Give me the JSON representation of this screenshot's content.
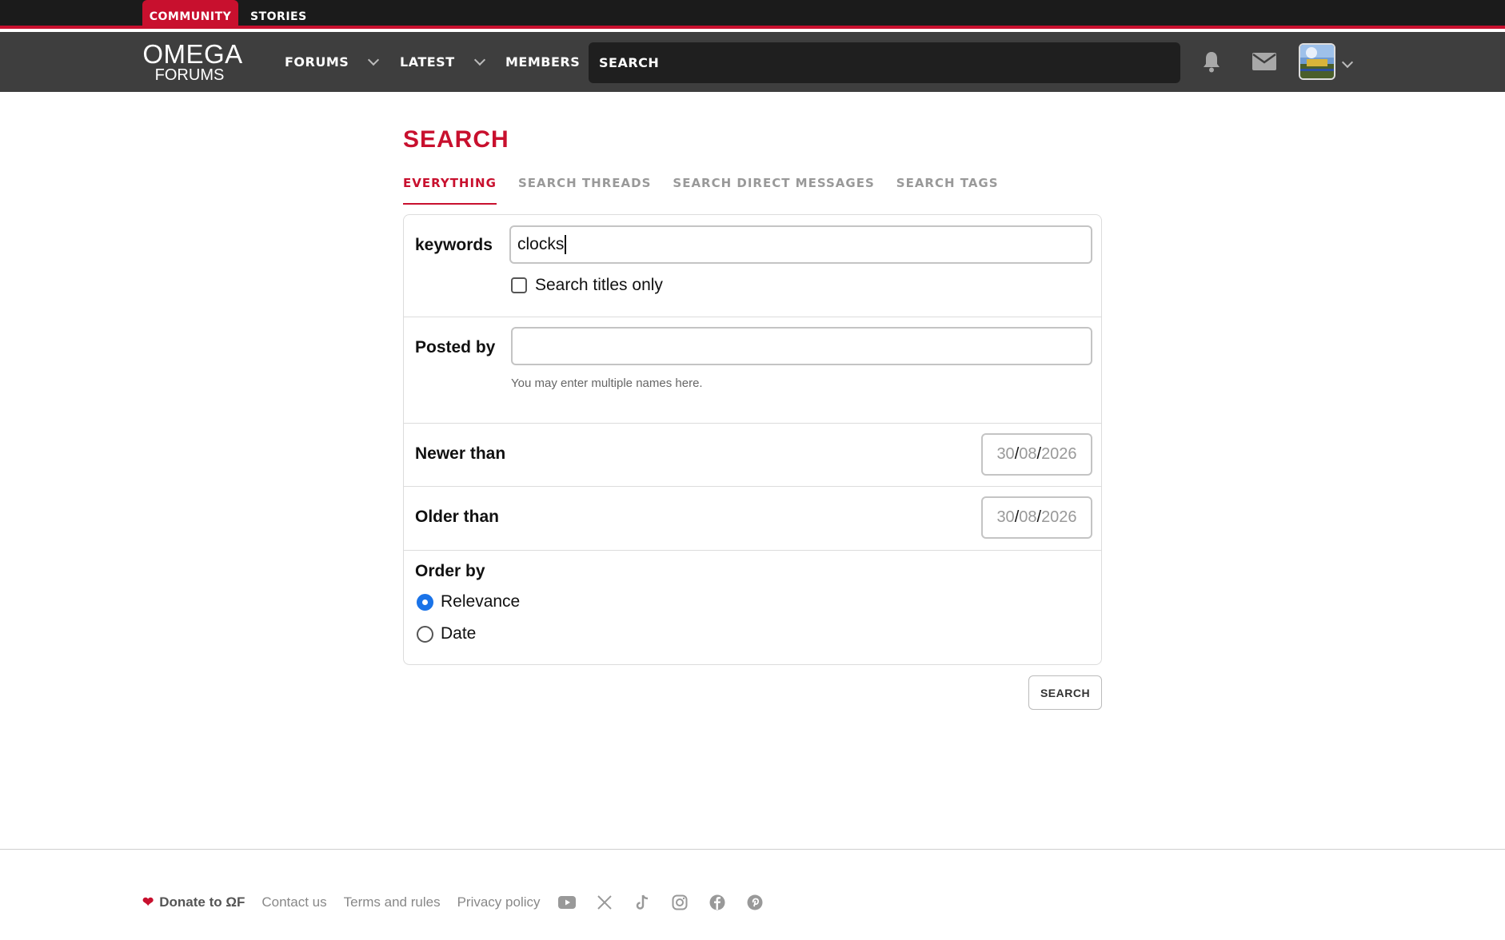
{
  "top_tabs": {
    "community": "COMMUNITY",
    "stories": "STORIES"
  },
  "logo": {
    "line1": "OMEGA",
    "line2": "FORUMS"
  },
  "nav": {
    "forums": "FORUMS",
    "latest": "LATEST",
    "members": "MEMBERS",
    "search": "SEARCH"
  },
  "page": {
    "title": "SEARCH",
    "tabs": [
      "EVERYTHING",
      "SEARCH THREADS",
      "SEARCH DIRECT MESSAGES",
      "SEARCH TAGS"
    ],
    "active_tab": "EVERYTHING"
  },
  "form": {
    "keywords_label": "keywords",
    "keywords_value": "clocks",
    "titles_only_label": "Search titles only",
    "titles_only_checked": false,
    "posted_by_label": "Posted by",
    "posted_by_value": "",
    "posted_by_hint": "You may enter multiple names here.",
    "newer_than_label": "Newer than",
    "newer_than": {
      "day": "30",
      "month": "08",
      "year": "2026"
    },
    "older_than_label": "Older than",
    "older_than": {
      "day": "30",
      "month": "08",
      "year": "2026"
    },
    "order_by_label": "Order by",
    "order_options": [
      "Relevance",
      "Date"
    ],
    "order_selected": "Relevance",
    "submit_label": "SEARCH"
  },
  "footer": {
    "donate": "Donate to ΩF",
    "links": [
      "Contact us",
      "Terms and rules",
      "Privacy policy"
    ],
    "social_icons": [
      "youtube-icon",
      "x-icon",
      "tiktok-icon",
      "instagram-icon",
      "facebook-icon",
      "pinterest-icon"
    ]
  },
  "colors": {
    "accent": "#c8102e",
    "navbar": "#3e3e3e",
    "topstrip": "#1b1b1b",
    "radio_selected": "#1a73e8"
  }
}
